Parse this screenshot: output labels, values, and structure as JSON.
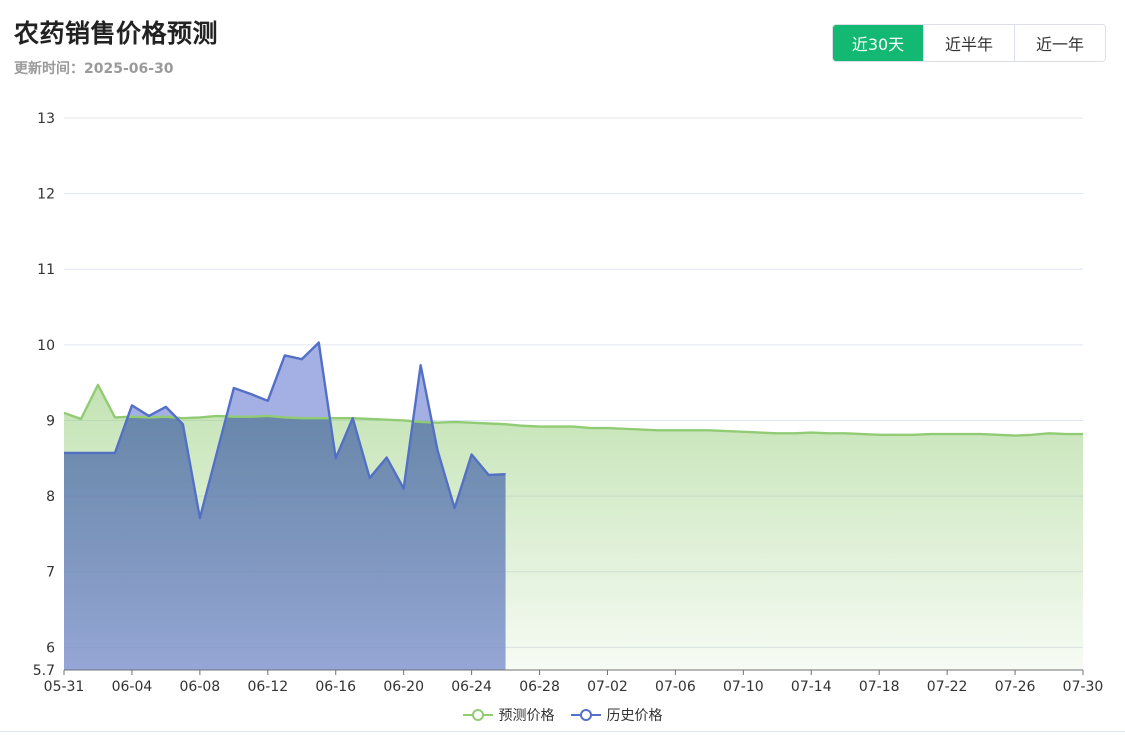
{
  "header": {
    "title": "农药销售价格预测",
    "updated": "更新时间：2025-06-30"
  },
  "range_buttons": [
    {
      "label": "近30天",
      "active": true
    },
    {
      "label": "近半年",
      "active": false
    },
    {
      "label": "近一年",
      "active": false
    }
  ],
  "colors": {
    "accent": "#13b872",
    "forecast": "#91cc75",
    "history": "#5470c6"
  },
  "chart_data": {
    "type": "area",
    "title": "",
    "xlabel": "",
    "ylabel": "",
    "ylim": [
      5.7,
      13
    ],
    "yticks": [
      "5.7",
      "6",
      "7",
      "8",
      "9",
      "10",
      "11",
      "12",
      "13"
    ],
    "grid": true,
    "legend_position": "bottom",
    "x": [
      "05-31",
      "06-01",
      "06-02",
      "06-03",
      "06-04",
      "06-05",
      "06-06",
      "06-07",
      "06-08",
      "06-09",
      "06-10",
      "06-11",
      "06-12",
      "06-13",
      "06-14",
      "06-15",
      "06-16",
      "06-17",
      "06-18",
      "06-19",
      "06-20",
      "06-21",
      "06-22",
      "06-23",
      "06-24",
      "06-25",
      "06-26",
      "06-27",
      "06-28",
      "06-29",
      "06-30",
      "07-01",
      "07-02",
      "07-03",
      "07-04",
      "07-05",
      "07-06",
      "07-07",
      "07-08",
      "07-09",
      "07-10",
      "07-11",
      "07-12",
      "07-13",
      "07-14",
      "07-15",
      "07-16",
      "07-17",
      "07-18",
      "07-19",
      "07-20",
      "07-21",
      "07-22",
      "07-23",
      "07-24",
      "07-25",
      "07-26",
      "07-27",
      "07-28",
      "07-29",
      "07-30"
    ],
    "xtick_labels": [
      "05-31",
      "06-04",
      "06-08",
      "06-12",
      "06-16",
      "06-20",
      "06-24",
      "06-28",
      "07-02",
      "07-06",
      "07-10",
      "07-14",
      "07-18",
      "07-22",
      "07-26",
      "07-30"
    ],
    "series": [
      {
        "name": "预测价格",
        "values": [
          9.1,
          9.02,
          9.47,
          9.04,
          9.05,
          9.04,
          9.05,
          9.03,
          9.04,
          9.06,
          9.05,
          9.05,
          9.06,
          9.04,
          9.03,
          9.03,
          9.03,
          9.03,
          9.02,
          9.01,
          9.0,
          8.98,
          8.97,
          8.98,
          8.97,
          8.96,
          8.95,
          8.93,
          8.92,
          8.92,
          8.92,
          8.9,
          8.9,
          8.89,
          8.88,
          8.87,
          8.87,
          8.87,
          8.87,
          8.86,
          8.85,
          8.84,
          8.83,
          8.83,
          8.84,
          8.83,
          8.83,
          8.82,
          8.81,
          8.81,
          8.81,
          8.82,
          8.82,
          8.82,
          8.82,
          8.81,
          8.8,
          8.81,
          8.83,
          8.82,
          8.82
        ]
      },
      {
        "name": "历史价格",
        "values": [
          8.57,
          8.57,
          8.57,
          8.57,
          9.2,
          9.06,
          9.18,
          8.95,
          7.71,
          8.57,
          9.43,
          9.35,
          9.26,
          9.86,
          9.81,
          10.03,
          8.5,
          9.03,
          8.24,
          8.51,
          8.1,
          9.73,
          8.6,
          7.84,
          8.55,
          8.28,
          8.29
        ]
      }
    ]
  }
}
